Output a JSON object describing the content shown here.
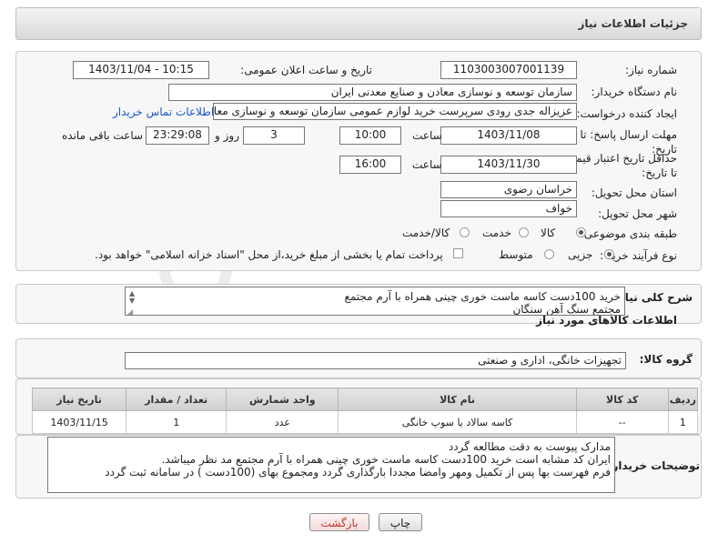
{
  "header": {
    "title": "جزئیات اطلاعات نیاز"
  },
  "form": {
    "need_number_label": "شماره نیاز:",
    "need_number": "1103003007001139",
    "announce_label": "تاریخ و ساعت اعلان عمومی:",
    "announce_value": "1403/11/04 - 10:15",
    "buyer_org_label": "نام دستگاه خریدار:",
    "buyer_org": "سازمان توسعه و نوسازی معادن و صنایع معدنی ایران",
    "creator_label": "ایجاد کننده درخواست:",
    "creator": "عزیزاله جدی رودی سرپرست خرید لوازم عمومی  سازمان توسعه و نوسازی معادن و صنایع معدنی ایران",
    "buyer_contact_link": "اطلاعات تماس خریدار",
    "reply_deadline_label": "مهلت ارسال پاسخ: تا تاریخ:",
    "reply_date": "1403/11/08",
    "time_label": "ساعت",
    "reply_time": "10:00",
    "days": "3",
    "days_label": "روز و",
    "remaining_time": "23:29:08",
    "remaining_label": "ساعت باقی مانده",
    "price_validity_label": "حداقل تاریخ اعتبار قیمت: تا تاریخ:",
    "validity_date": "1403/11/30",
    "validity_time": "16:00",
    "province_label": "استان محل تحویل:",
    "province": "خراسان رضوی",
    "city_label": "شهر محل تحویل:",
    "city": "خواف",
    "category_label": "طبقه بندی موضوعی:",
    "category_options": [
      "کالا",
      "خدمت",
      "کالا/خدمت"
    ],
    "purchase_type_label": "نوع فرآیند خرید :",
    "purchase_options": [
      "جزیی",
      "متوسط"
    ],
    "payment_note": "پرداخت تمام یا بخشی از مبلغ خرید،از محل \"اسناد خزانه اسلامی\" خواهد بود."
  },
  "description": {
    "label": "شرح کلی نیاز:",
    "line1": "خرید 100دست کاسه ماست خوری چینی همراه با آرم مجتمع",
    "line2": "مجتمع سنگ آهن سنگان"
  },
  "goods_section": {
    "title": "اطلاعات کالاهای مورد نیاز",
    "group_label": "گروه کالا:",
    "group_value": "تجهیزات خانگی، اداری و صنعتی"
  },
  "table": {
    "headers": [
      "ردیف",
      "کد کالا",
      "نام کالا",
      "واحد شمارش",
      "تعداد / مقدار",
      "تاریخ نیاز"
    ],
    "rows": [
      [
        "1",
        "--",
        "کاسه سالاد یا سوپ خانگی",
        "عدد",
        "1",
        "1403/11/15"
      ]
    ]
  },
  "buyer_notes": {
    "label": "توضیحات خریدار:",
    "line1": "مدارک پیوست به دقت مطالعه گردد",
    "line2": "ایران کد مشابه است خرید 100دست کاسه ماست خوری چینی همراه با آرم مجتمع مد نظر میباشد.",
    "line3": "فرم فهرست بها پس از تکمیل ومهر وامضا مجددا بارگذاری گردد ومجموع بهای (100دست ) در سامانه ثبت گردد"
  },
  "buttons": {
    "print": "چاپ",
    "back": "بازگشت"
  },
  "colors": {
    "link": "#1a56c9",
    "back_button_text": "#c0392b"
  }
}
